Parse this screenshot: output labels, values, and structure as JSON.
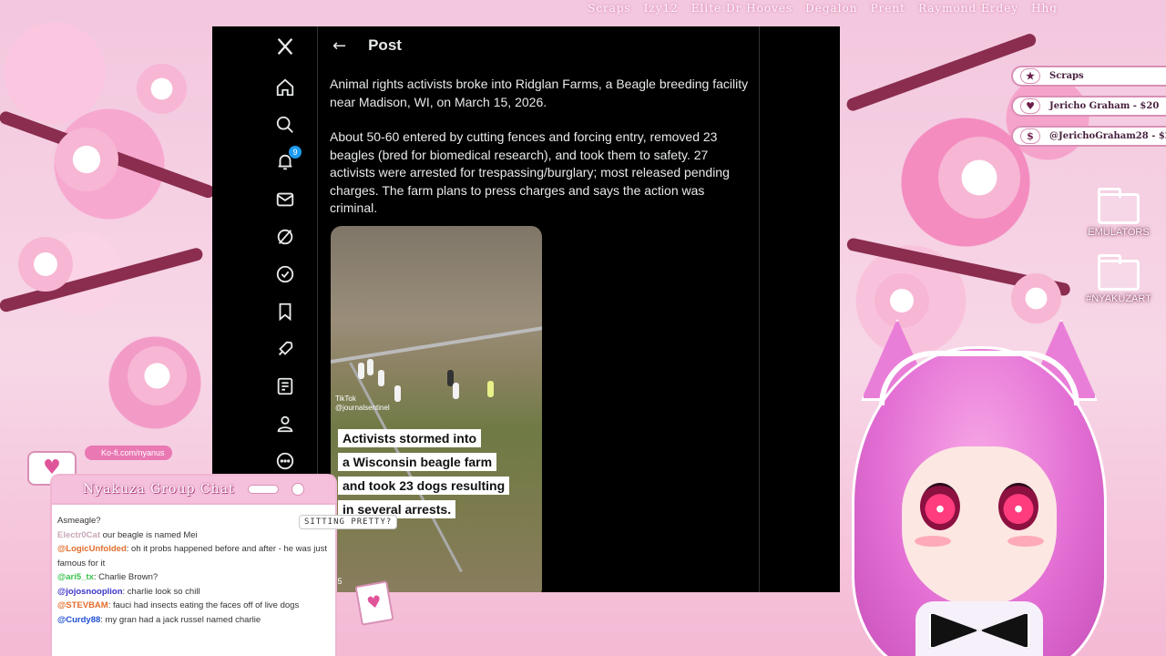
{
  "ticker": [
    "Scraps",
    "Izy12",
    "Elite Dr Hooves",
    "Degalon",
    "Prent",
    "Raymond Erdey",
    "Hhg"
  ],
  "nav": {
    "notification_count": "9"
  },
  "post": {
    "header_title": "Post",
    "paragraph1": "Animal rights activists broke into Ridglan Farms, a Beagle breeding facility near Madison, WI, on March 15, 2026.",
    "paragraph2": "About 50-60 entered by cutting fences and forcing entry, removed 23 beagles (bred for biomedical research), and took them to safety.  27 activists were arrested for trespassing/burglary; most released pending charges. The farm plans to press charges and says the action was criminal.",
    "video": {
      "tiktok_label": "TikTok",
      "tiktok_handle": "@journalsentinel",
      "captions": [
        "Activists stormed into",
        "a Wisconsin beagle farm",
        "and took 23 dogs resulting",
        "in several arrests."
      ],
      "duration": "1:5"
    }
  },
  "alerts": [
    {
      "icon": "★",
      "text": "Scraps"
    },
    {
      "icon": "♥",
      "text": "Jericho Graham - $20"
    },
    {
      "icon": "$",
      "text": "@JerichoGraham28 - $2"
    }
  ],
  "folders": [
    "EMULATORS",
    "#NYAKUZART"
  ],
  "kofi": "Ko-fi.com/nyanus",
  "chat": {
    "title": "Nyakuza Group Chat",
    "messages": [
      {
        "user": "",
        "text": "Asmeagle?"
      },
      {
        "user": "Electr0Cat",
        "text": " our beagle is named Mei"
      },
      {
        "user": "@LogicUnfolded",
        "text": ": oh it probs happened before and after - he was just famous for it"
      },
      {
        "user": "@ari5_tx",
        "text": ": Charlie Brown?"
      },
      {
        "user": "@jojosnooplion",
        "text": ": charlie look so chill"
      },
      {
        "user": "@STEVBAM",
        "text": ": fauci had insects eating the faces off of live dogs"
      },
      {
        "user": "@Curdy88",
        "text": ": my gran had a jack russel named charlie"
      }
    ]
  },
  "sitting_label": "SITTING PRETTY?",
  "colors": {
    "accent_pink": "#e978b3",
    "x_bg": "#000000",
    "x_text": "#e7e9ea",
    "badge_blue": "#1d9bf0"
  }
}
